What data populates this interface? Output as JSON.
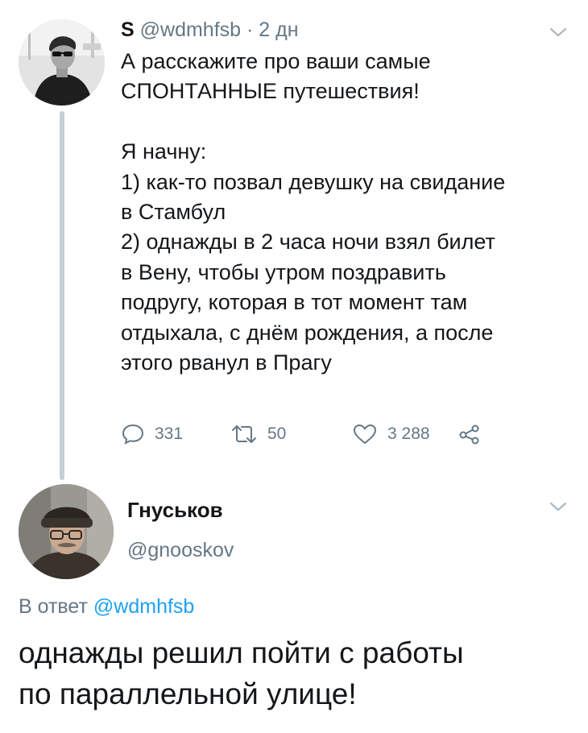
{
  "tweet": {
    "author_name": "S",
    "author_handle": "@wdmhfsb",
    "separator": "·",
    "time": "2 дн",
    "lines": [
      "А расскажите про ваши самые",
      "СПОНТАННЫЕ путешествия!",
      "",
      "Я начну:",
      "1) как-то позвал девушку на свидание",
      "в Стамбул",
      "2) однажды в 2 часа ночи взял билет",
      "в Вену, чтобы утром поздравить",
      "подругу, которая в тот момент там",
      "отдыхала, с днём рождения, а после",
      "этого рванул в Прагу"
    ],
    "replies_count": "331",
    "retweets_count": "50",
    "likes_count": "3 288"
  },
  "reply": {
    "author_name": "Гнуськов",
    "author_handle": "@gnooskov",
    "reply_prefix": "В ответ",
    "reply_mention": "@wdmhfsb",
    "lines": [
      "однажды решил пойти с работы",
      "по параллельной улице!"
    ]
  },
  "icons": {
    "reply": "comment-icon",
    "retweet": "retweet-icon",
    "like": "heart-icon",
    "share": "share-icon",
    "menu": "chevron-down-icon"
  },
  "colors": {
    "text": "#14171a",
    "secondary": "#657786",
    "link": "#1da1f2",
    "thread_line": "#c4cfd6"
  }
}
